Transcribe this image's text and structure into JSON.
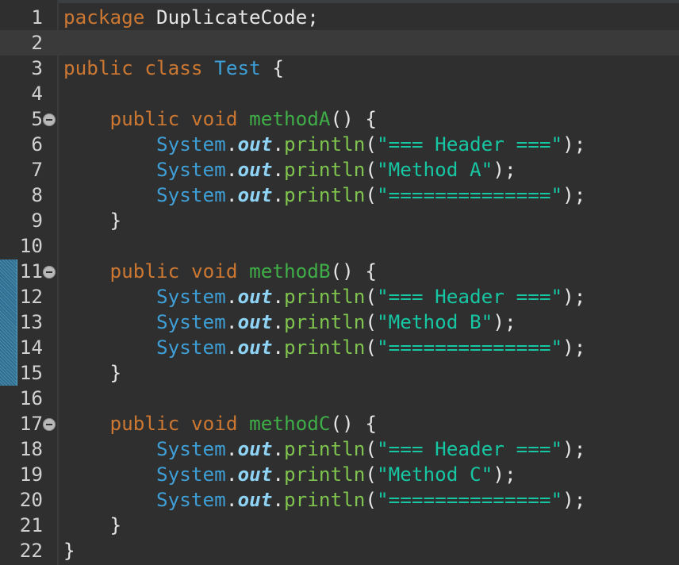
{
  "editor": {
    "lines": [
      {
        "n": "1",
        "tokens": [
          {
            "t": "package",
            "c": "kw"
          },
          {
            "t": " DuplicateCode;",
            "c": "plain"
          }
        ]
      },
      {
        "n": "2",
        "current": true,
        "tokens": []
      },
      {
        "n": "3",
        "tokens": [
          {
            "t": "public",
            "c": "kw"
          },
          {
            "t": " ",
            "c": "plain"
          },
          {
            "t": "class",
            "c": "kw"
          },
          {
            "t": " ",
            "c": "plain"
          },
          {
            "t": "Test",
            "c": "cls"
          },
          {
            "t": " {",
            "c": "plain"
          }
        ]
      },
      {
        "n": "4",
        "tokens": []
      },
      {
        "n": "5",
        "fold": true,
        "tokens": [
          {
            "t": "    ",
            "c": "plain"
          },
          {
            "t": "public",
            "c": "kw"
          },
          {
            "t": " ",
            "c": "plain"
          },
          {
            "t": "void",
            "c": "kw"
          },
          {
            "t": " ",
            "c": "plain"
          },
          {
            "t": "methodA",
            "c": "mth"
          },
          {
            "t": "() {",
            "c": "plain"
          }
        ]
      },
      {
        "n": "6",
        "tokens": [
          {
            "t": "        ",
            "c": "plain"
          },
          {
            "t": "System",
            "c": "sys"
          },
          {
            "t": ".",
            "c": "plain"
          },
          {
            "t": "out",
            "c": "out"
          },
          {
            "t": ".",
            "c": "plain"
          },
          {
            "t": "println",
            "c": "pr"
          },
          {
            "t": "(",
            "c": "plain"
          },
          {
            "t": "\"=== Header ===\"",
            "c": "str"
          },
          {
            "t": ");",
            "c": "plain"
          }
        ]
      },
      {
        "n": "7",
        "tokens": [
          {
            "t": "        ",
            "c": "plain"
          },
          {
            "t": "System",
            "c": "sys"
          },
          {
            "t": ".",
            "c": "plain"
          },
          {
            "t": "out",
            "c": "out"
          },
          {
            "t": ".",
            "c": "plain"
          },
          {
            "t": "println",
            "c": "pr"
          },
          {
            "t": "(",
            "c": "plain"
          },
          {
            "t": "\"Method A\"",
            "c": "str"
          },
          {
            "t": ");",
            "c": "plain"
          }
        ]
      },
      {
        "n": "8",
        "tokens": [
          {
            "t": "        ",
            "c": "plain"
          },
          {
            "t": "System",
            "c": "sys"
          },
          {
            "t": ".",
            "c": "plain"
          },
          {
            "t": "out",
            "c": "out"
          },
          {
            "t": ".",
            "c": "plain"
          },
          {
            "t": "println",
            "c": "pr"
          },
          {
            "t": "(",
            "c": "plain"
          },
          {
            "t": "\"==============\"",
            "c": "str"
          },
          {
            "t": ");",
            "c": "plain"
          }
        ]
      },
      {
        "n": "9",
        "tokens": [
          {
            "t": "    }",
            "c": "plain"
          }
        ]
      },
      {
        "n": "10",
        "tokens": []
      },
      {
        "n": "11",
        "fold": true,
        "tokens": [
          {
            "t": "    ",
            "c": "plain"
          },
          {
            "t": "public",
            "c": "kw"
          },
          {
            "t": " ",
            "c": "plain"
          },
          {
            "t": "void",
            "c": "kw"
          },
          {
            "t": " ",
            "c": "plain"
          },
          {
            "t": "methodB",
            "c": "mth"
          },
          {
            "t": "() {",
            "c": "plain"
          }
        ]
      },
      {
        "n": "12",
        "tokens": [
          {
            "t": "        ",
            "c": "plain"
          },
          {
            "t": "System",
            "c": "sys"
          },
          {
            "t": ".",
            "c": "plain"
          },
          {
            "t": "out",
            "c": "out"
          },
          {
            "t": ".",
            "c": "plain"
          },
          {
            "t": "println",
            "c": "pr"
          },
          {
            "t": "(",
            "c": "plain"
          },
          {
            "t": "\"=== Header ===\"",
            "c": "str"
          },
          {
            "t": ");",
            "c": "plain"
          }
        ]
      },
      {
        "n": "13",
        "tokens": [
          {
            "t": "        ",
            "c": "plain"
          },
          {
            "t": "System",
            "c": "sys"
          },
          {
            "t": ".",
            "c": "plain"
          },
          {
            "t": "out",
            "c": "out"
          },
          {
            "t": ".",
            "c": "plain"
          },
          {
            "t": "println",
            "c": "pr"
          },
          {
            "t": "(",
            "c": "plain"
          },
          {
            "t": "\"Method B\"",
            "c": "str"
          },
          {
            "t": ");",
            "c": "plain"
          }
        ]
      },
      {
        "n": "14",
        "tokens": [
          {
            "t": "        ",
            "c": "plain"
          },
          {
            "t": "System",
            "c": "sys"
          },
          {
            "t": ".",
            "c": "plain"
          },
          {
            "t": "out",
            "c": "out"
          },
          {
            "t": ".",
            "c": "plain"
          },
          {
            "t": "println",
            "c": "pr"
          },
          {
            "t": "(",
            "c": "plain"
          },
          {
            "t": "\"==============\"",
            "c": "str"
          },
          {
            "t": ");",
            "c": "plain"
          }
        ]
      },
      {
        "n": "15",
        "tokens": [
          {
            "t": "    }",
            "c": "plain"
          }
        ]
      },
      {
        "n": "16",
        "tokens": []
      },
      {
        "n": "17",
        "fold": true,
        "tokens": [
          {
            "t": "    ",
            "c": "plain"
          },
          {
            "t": "public",
            "c": "kw"
          },
          {
            "t": " ",
            "c": "plain"
          },
          {
            "t": "void",
            "c": "kw"
          },
          {
            "t": " ",
            "c": "plain"
          },
          {
            "t": "methodC",
            "c": "mth"
          },
          {
            "t": "() {",
            "c": "plain"
          }
        ]
      },
      {
        "n": "18",
        "tokens": [
          {
            "t": "        ",
            "c": "plain"
          },
          {
            "t": "System",
            "c": "sys"
          },
          {
            "t": ".",
            "c": "plain"
          },
          {
            "t": "out",
            "c": "out"
          },
          {
            "t": ".",
            "c": "plain"
          },
          {
            "t": "println",
            "c": "pr"
          },
          {
            "t": "(",
            "c": "plain"
          },
          {
            "t": "\"=== Header ===\"",
            "c": "str"
          },
          {
            "t": ");",
            "c": "plain"
          }
        ]
      },
      {
        "n": "19",
        "tokens": [
          {
            "t": "        ",
            "c": "plain"
          },
          {
            "t": "System",
            "c": "sys"
          },
          {
            "t": ".",
            "c": "plain"
          },
          {
            "t": "out",
            "c": "out"
          },
          {
            "t": ".",
            "c": "plain"
          },
          {
            "t": "println",
            "c": "pr"
          },
          {
            "t": "(",
            "c": "plain"
          },
          {
            "t": "\"Method C\"",
            "c": "str"
          },
          {
            "t": ");",
            "c": "plain"
          }
        ]
      },
      {
        "n": "20",
        "tokens": [
          {
            "t": "        ",
            "c": "plain"
          },
          {
            "t": "System",
            "c": "sys"
          },
          {
            "t": ".",
            "c": "plain"
          },
          {
            "t": "out",
            "c": "out"
          },
          {
            "t": ".",
            "c": "plain"
          },
          {
            "t": "println",
            "c": "pr"
          },
          {
            "t": "(",
            "c": "plain"
          },
          {
            "t": "\"==============\"",
            "c": "str"
          },
          {
            "t": ");",
            "c": "plain"
          }
        ]
      },
      {
        "n": "21",
        "tokens": [
          {
            "t": "    }",
            "c": "plain"
          }
        ]
      },
      {
        "n": "22",
        "tokens": [
          {
            "t": "}",
            "c": "plain"
          }
        ]
      }
    ]
  },
  "colors": {
    "background": "#2f2f2f",
    "keyword": "#cc7832",
    "class_name": "#3d9fd6",
    "method_name": "#3fae49",
    "field_out": "#8fd3f5",
    "string": "#17c6a3",
    "range_marker": "#2c6f93"
  },
  "icons": {
    "fold": "fold-collapse-icon"
  }
}
